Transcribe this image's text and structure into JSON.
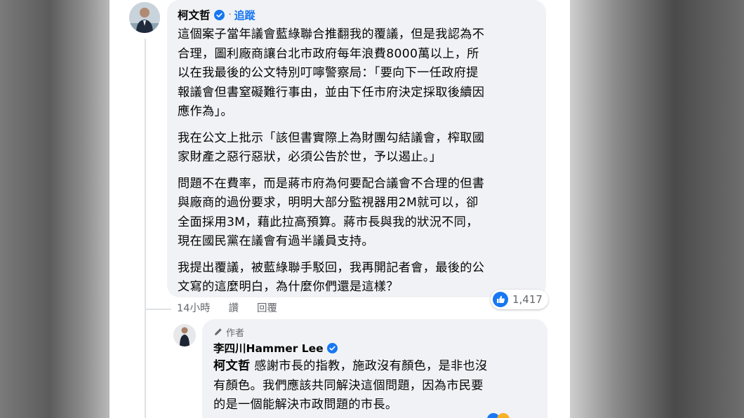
{
  "comment": {
    "author": "柯文哲",
    "verified": true,
    "separator": "·",
    "follow_label": "追蹤",
    "paragraphs": [
      "這個案子當年議會藍綠聯合推翻我的覆議，但是我認為不\n合理，圖利廠商讓台北市政府每年浪費8000萬以上，所\n以在我最後的公文特別叮嚀警察局：「要向下一任政府提\n報議會但書窒礙難行事由，並由下任市府決定採取後續因\n應作為」。",
      "我在公文上批示「該但書實際上為財團勾結議會，榨取國\n家財產之惡行惡狀，必須公告於世，予以遏止。」",
      "問題不在費率，而是蔣市府為何要配合議會不合理的但書\n與廠商的過份要求，明明大部分監視器用2M就可以，卻\n全面採用3M，藉此拉高預算。蔣市長與我的狀況不同，\n現在國民黨在議會有過半議員支持。",
      "我提出覆議，被藍綠聯手駁回，我再開記者會，最後的公\n文寫的這麼明白，為什麼你們還是這樣？"
    ],
    "time": "14小時",
    "like_action": "讚",
    "reply_action": "回覆",
    "reaction_icon": "like-icon",
    "reaction_count": "1,417",
    "like_color": "#1877f2"
  },
  "reply": {
    "author_badge": "作者",
    "author": "李四川Hammer Lee",
    "verified": true,
    "mention": "柯文哲",
    "text": " 感謝市長的指教，施政沒有顏色，是非也沒\n有顏色。我們應該共同解決這個問題，因為市民要\n的是一個能解決市政問題的市長。"
  }
}
